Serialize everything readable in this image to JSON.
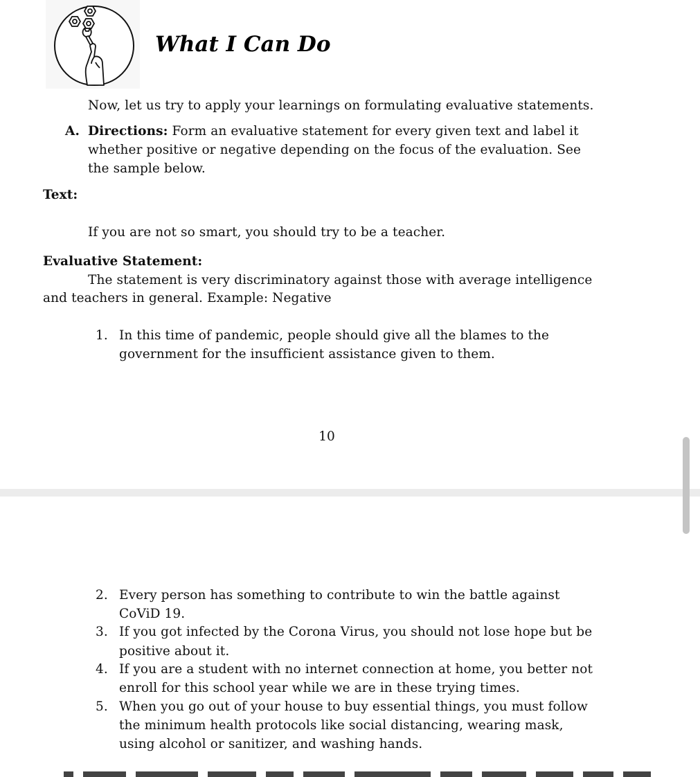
{
  "header": {
    "icon": "wrench-bolts-hand-icon",
    "title": "What I Can Do"
  },
  "intro": "Now, let us try to apply your learnings on formulating evaluative statements.",
  "directions": {
    "letter": "A.",
    "label": "Directions:",
    "lines": [
      " Form an evaluative statement for every given text and label it",
      "whether positive or negative depending on the focus of the evaluation. See",
      "the sample below."
    ]
  },
  "sample": {
    "text_label": "Text:",
    "text": "If you are not so smart, you should try to be a teacher.",
    "statement_label": "Evaluative Statement:",
    "statement_lines": [
      "The statement is very discriminatory against those with average intelligence",
      "and teachers in general. Example: Negative"
    ]
  },
  "items": [
    {
      "number": "1.",
      "lines": [
        "In this time of pandemic, people should give all the blames to the",
        "government for the insufficient assistance given to them."
      ]
    },
    {
      "number": "2.",
      "lines": [
        "Every person has something to contribute to win the battle against",
        "CoViD 19."
      ]
    },
    {
      "number": "3.",
      "lines": [
        "If you got infected by the Corona Virus, you should not lose hope but be",
        "positive about it."
      ]
    },
    {
      "number": "4.",
      "lines": [
        "If you are a student with no internet connection at home, you better not",
        "enroll for this school year while we are in these trying times."
      ]
    },
    {
      "number": "5.",
      "lines": [
        "When you go out of your house to buy essential things, you must follow",
        "the minimum health protocols like social distancing, wearing mask,",
        "using alcohol or sanitizer, and washing hands."
      ]
    }
  ],
  "page_number": "10",
  "colors": {
    "page_background": "#ffffff",
    "page_gap": "#ececec",
    "scrollbar_thumb": "#c4c4c4",
    "text": "#111111"
  }
}
